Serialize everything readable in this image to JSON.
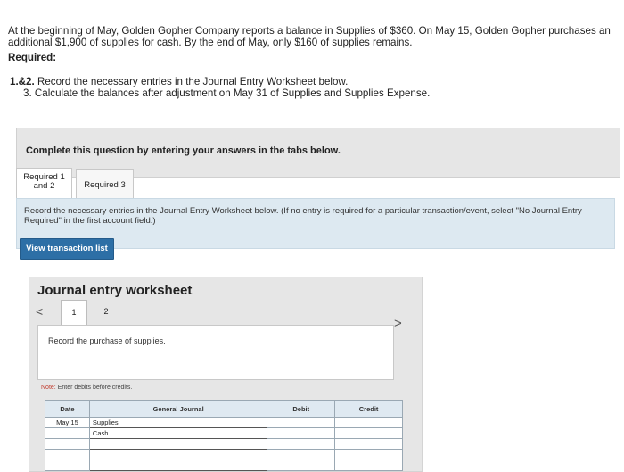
{
  "problem": {
    "text": "At the beginning of May, Golden Gopher Company reports a balance in Supplies of $360. On May 15, Golden Gopher purchases an additional $1,900 of supplies for cash. By the end of May, only $160 of supplies remains.",
    "required_heading": "Required:",
    "req1_num": "1.&2.",
    "req1_text": "Record the necessary entries in the Journal Entry Worksheet below.",
    "req2_text": "3. Calculate the balances after adjustment on May 31 of Supplies and Supplies Expense."
  },
  "complete_banner": "Complete this question by entering your answers in the tabs below.",
  "tabs": [
    {
      "label_line1": "Required 1",
      "label_line2": "and 2"
    },
    {
      "label": "Required 3"
    }
  ],
  "instruction": "Record the necessary entries in the Journal Entry Worksheet below. (If no entry is required for a particular transaction/event, select \"No Journal Entry Required\" in the first account field.)",
  "view_button": "View transaction list",
  "worksheet": {
    "title": "Journal entry worksheet",
    "prev": "<",
    "next": ">",
    "pages": [
      "1",
      "2"
    ],
    "description": "Record the purchase of supplies.",
    "note_label": "Note:",
    "note_text": "Enter debits before credits."
  },
  "table": {
    "headers": {
      "date": "Date",
      "account": "General Journal",
      "debit": "Debit",
      "credit": "Credit"
    },
    "rows": [
      {
        "date": "May 15",
        "account": "Supplies",
        "debit": "",
        "credit": ""
      },
      {
        "date": "",
        "account": "Cash",
        "debit": "",
        "credit": ""
      },
      {
        "date": "",
        "account": "",
        "debit": "",
        "credit": ""
      },
      {
        "date": "",
        "account": "",
        "debit": "",
        "credit": ""
      },
      {
        "date": "",
        "account": "",
        "debit": "",
        "credit": ""
      }
    ]
  }
}
